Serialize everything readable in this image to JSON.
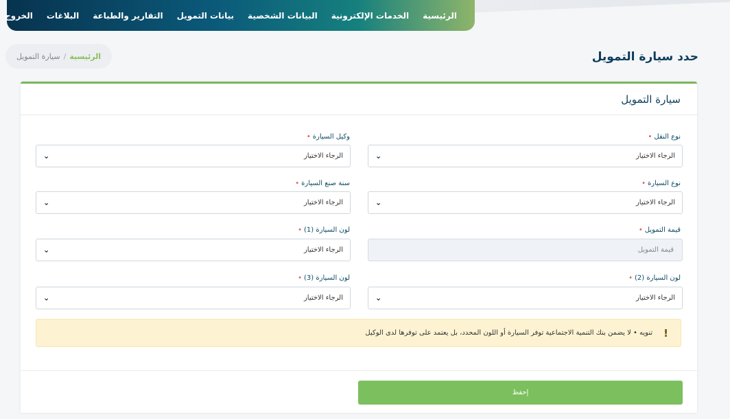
{
  "nav": {
    "items": [
      "الرئيسية",
      "الخدمات الإلكترونية",
      "البيانات الشخصية",
      "بيانات التمويل",
      "التقارير والطباعة",
      "البلاغات",
      "الخروج"
    ]
  },
  "page": {
    "title": "حدد سيارة التمويل"
  },
  "breadcrumb": {
    "home": "الرئيسية",
    "separator": "/",
    "current": "سيارة التمويل"
  },
  "card": {
    "title": "سيارة التمويل"
  },
  "form": {
    "required_mark": "•",
    "transport_type": {
      "label": "نوع النقل",
      "value": "الرجاء الاختيار"
    },
    "car_agent": {
      "label": "وكيل السيارة",
      "value": "الرجاء الاختيار"
    },
    "car_type": {
      "label": "نوع السيارة",
      "value": "الرجاء الاختيار"
    },
    "manufacture_year": {
      "label": "سنة صنع السيارة",
      "value": "الرجاء الاختيار"
    },
    "finance_value": {
      "label": "قيمة التمويل",
      "placeholder": "قيمة التمويل"
    },
    "car_color_1": {
      "label": "لون السيارة (1)",
      "value": "الرجاء الاختيار"
    },
    "car_color_2": {
      "label": "لون السيارة (2)",
      "value": "الرجاء الاختيار"
    },
    "car_color_3": {
      "label": "لون السيارة (3)",
      "value": "الرجاء الاختيار"
    }
  },
  "alert": {
    "icon": "exclamation-icon",
    "text": "تنويه • لا يضمن بنك التنمية الاجتماعية توفر السيارة أو اللون المحدد، بل يعتمد على توفرها لدى الوكيل"
  },
  "actions": {
    "save_label": "إحفظ"
  },
  "colors": {
    "nav_dark": "#07334f",
    "accent_green": "#7cbf5f",
    "title_blue": "#0c3d5c",
    "required_red": "#e25555",
    "alert_bg": "#fdf3d2"
  }
}
